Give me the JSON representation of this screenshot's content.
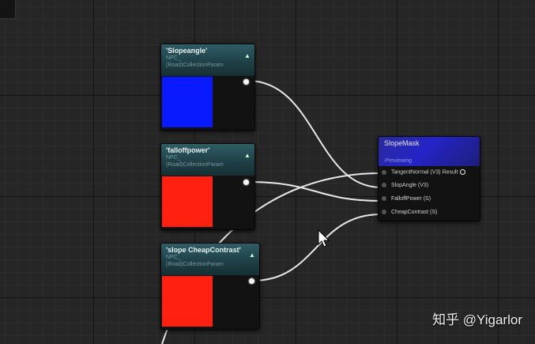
{
  "nodes": [
    {
      "title": "'Slopeangle'",
      "sub1": "NPC_",
      "sub2": "(Road)CollectionParam",
      "color": "#0a1aff"
    },
    {
      "title": "'falloffpower'",
      "sub1": "NPC_",
      "sub2": "(Road)CollectionParam",
      "color": "#ff2010"
    },
    {
      "title": "'slope CheapContrast'",
      "sub1": "NPC_",
      "sub2": "(Road)CollectionParam",
      "color": "#ff2010"
    }
  ],
  "function_node": {
    "title": "SlopeMask",
    "sub": "Previewing",
    "pins": [
      "TangentNormal (V3)",
      "SlopAngle (V3)",
      "FalloffPower (S)",
      "CheapContrast (S)"
    ],
    "result_label": "Result"
  },
  "watermark": "知乎 @Yigarlor",
  "colors": {
    "wire": "#e8e8e8",
    "header": "#2f5d66",
    "function_header": "#2424c8"
  }
}
